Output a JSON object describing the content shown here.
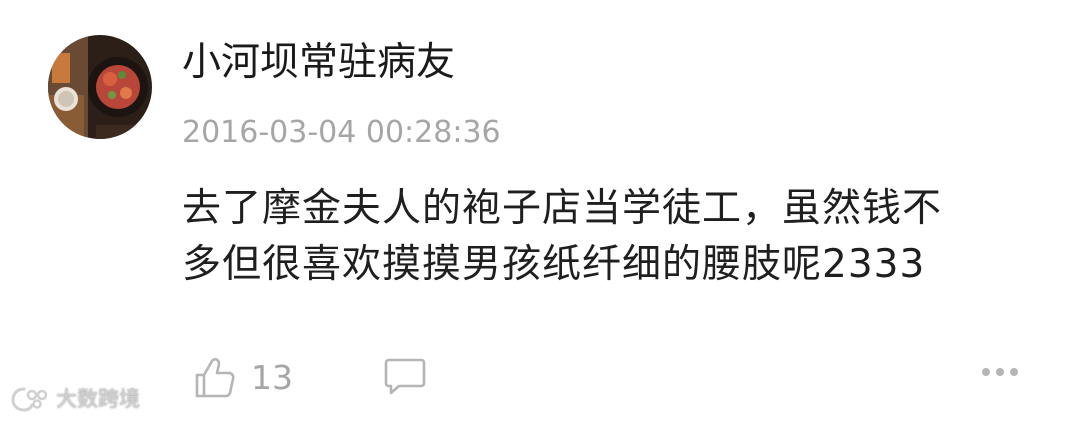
{
  "comment": {
    "username": "小河坝常驻病友",
    "timestamp": "2016-03-04 00:28:36",
    "body_lines": [
      "去了摩金夫人的袍子店当学徒工，虽然钱不",
      "多但很喜欢摸摸男孩纸纤细的腰肢呢2333"
    ],
    "like_count": "13"
  },
  "icons": {
    "like": "thumbs-up-icon",
    "reply": "comment-bubble-icon",
    "more": "more-dots-icon"
  },
  "watermark": {
    "text": "大数跨境"
  },
  "colors": {
    "text_primary": "#1a1a1a",
    "text_secondary": "#a6a6a6",
    "icon": "#b5b5b5"
  }
}
